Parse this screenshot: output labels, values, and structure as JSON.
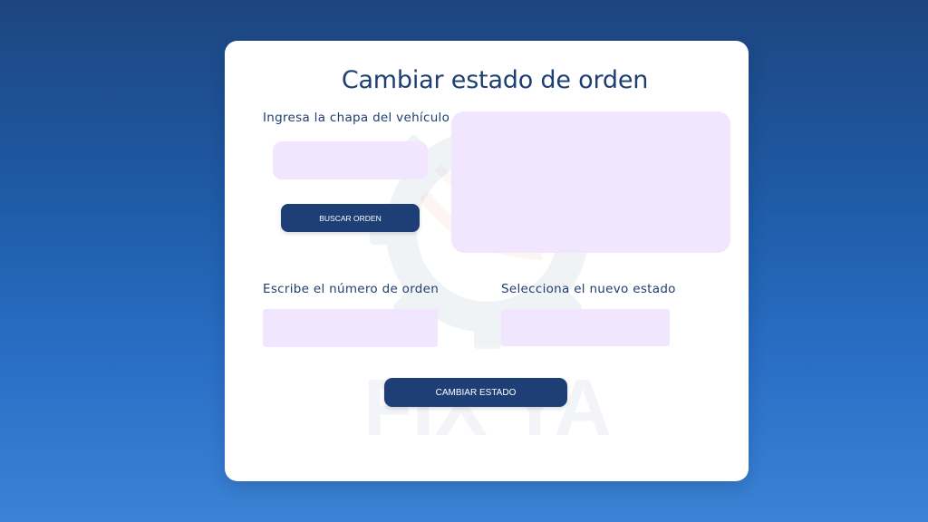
{
  "form": {
    "title": "Cambiar estado de orden",
    "plate_label": "Ingresa la chapa del vehículo",
    "plate_value": "",
    "search_button": "BUSCAR ORDEN",
    "order_label": "Escribe el número de orden",
    "order_value": "",
    "status_label": "Selecciona el nuevo estado",
    "status_value": "",
    "submit_button": "CAMBIAR ESTADO"
  },
  "watermark": {
    "logo_icon": "gear-logo-icon",
    "text": "FIX YA"
  },
  "colors": {
    "background_top": "#1d4580",
    "background_bottom": "#3b83d4",
    "card": "#ffffff",
    "field": "#f1e6fd",
    "button": "#1e3f75",
    "text": "#1d3f74"
  }
}
